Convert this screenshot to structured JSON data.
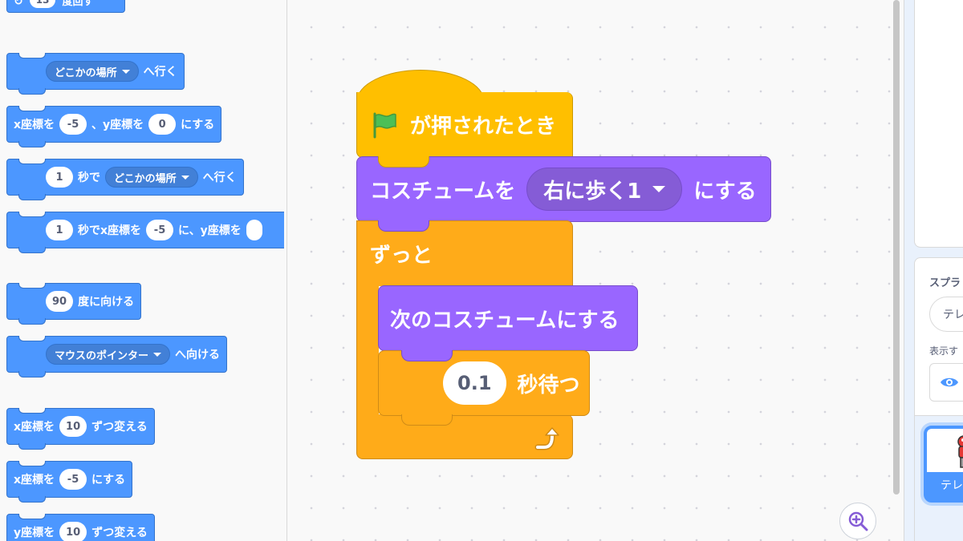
{
  "palette": {
    "partial_top": {
      "value": "13",
      "label": "度回す"
    },
    "go_to": {
      "menu": "どこかの場所",
      "suffix": "へ行く"
    },
    "go_xy": {
      "pre": "x座標を",
      "x": "-5",
      "mid": "、y座標を",
      "y": "0",
      "suffix": "にする"
    },
    "glide_to": {
      "secs": "1",
      "mid": "秒で",
      "menu": "どこかの場所",
      "suffix": "へ行く"
    },
    "glide_xy": {
      "secs": "1",
      "mid": "秒でx座標を",
      "x": "-5",
      "mid2": "に、y座標を"
    },
    "point_dir": {
      "value": "90",
      "suffix": "度に向ける"
    },
    "point_towards": {
      "menu": "マウスのポインター",
      "suffix": "へ向ける"
    },
    "change_x": {
      "pre": "x座標を",
      "value": "10",
      "suffix": "ずつ変える"
    },
    "set_x": {
      "pre": "x座標を",
      "value": "-5",
      "suffix": "にする"
    },
    "change_y": {
      "pre": "y座標を",
      "value": "10",
      "suffix": "ずつ変える"
    }
  },
  "script": {
    "hat_label": "が押されたとき",
    "switch_costume": {
      "pre": "コスチュームを",
      "menu": "右に歩く1",
      "suffix": "にする"
    },
    "forever_label": "ずっと",
    "next_costume": "次のコスチュームにする",
    "wait": {
      "value": "0.1",
      "suffix": "秒待つ"
    }
  },
  "sprite_info": {
    "sprite_label": "スプラ",
    "name_value": "テレ",
    "show_label": "表示す"
  },
  "sprite_list": {
    "selected_name": "テレ"
  },
  "icons": {
    "green_flag": "green-flag-icon",
    "loop_arrow": "loop-arrow-icon",
    "zoom": "zoom-in-icon",
    "eye": "eye-icon"
  },
  "colors": {
    "motion": "#4c97ff",
    "events": "#ffbf00",
    "control": "#ffab19",
    "looks": "#9966ff"
  }
}
